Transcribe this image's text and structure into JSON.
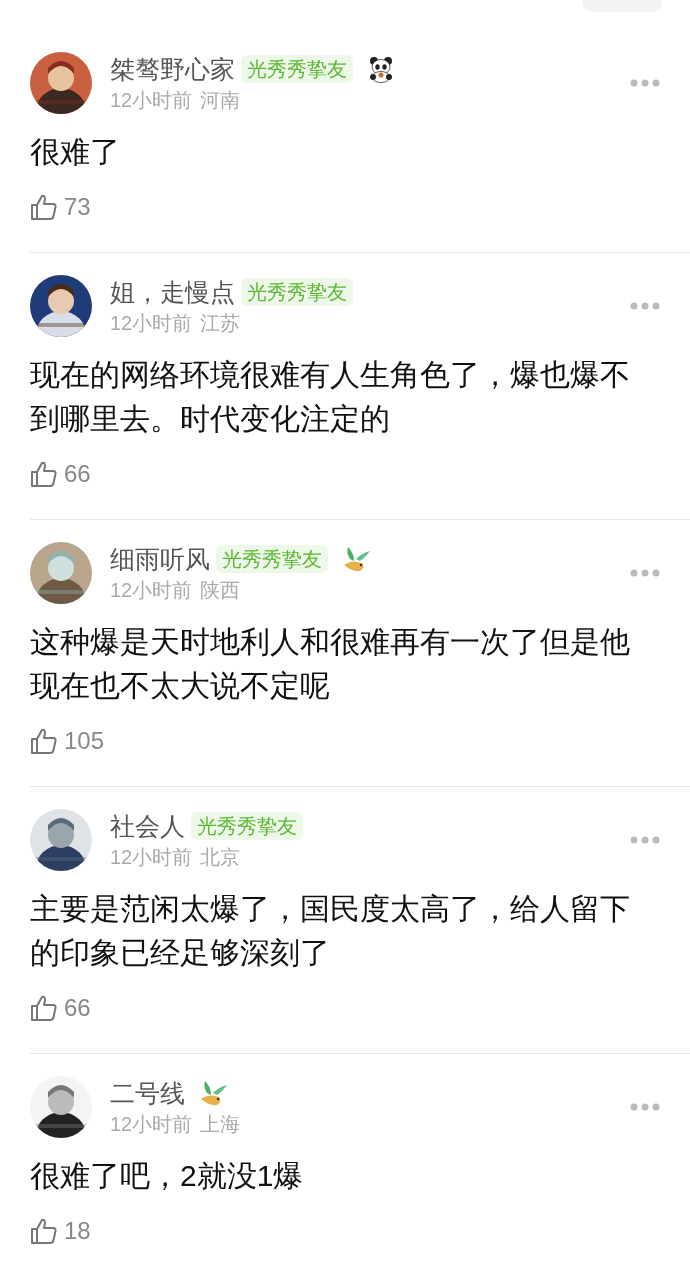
{
  "comments": [
    {
      "name": "桀骜野心家",
      "badge": "光秀秀挚友",
      "emblem": {
        "kind": "panda"
      },
      "time": "12小时前",
      "region": "河南",
      "text": "很难了",
      "likes": "73"
    },
    {
      "name": "姐，走慢点",
      "badge": "光秀秀挚友",
      "time": "12小时前",
      "region": "江苏",
      "text": "现在的网络环境很难有人生角色了，爆也爆不到哪里去。时代变化注定的",
      "likes": "66"
    },
    {
      "name": "细雨听风",
      "badge": "光秀秀挚友",
      "emblem": {
        "kind": "bird"
      },
      "time": "12小时前",
      "region": "陕西",
      "text": "这种爆是天时地利人和很难再有一次了但是他现在也不太大说不定呢",
      "likes": "105"
    },
    {
      "name": "社会人",
      "badge": "光秀秀挚友",
      "time": "12小时前",
      "region": "北京",
      "text": "主要是范闲太爆了，国民度太高了，给人留下的印象已经足够深刻了",
      "likes": "66"
    },
    {
      "name": "二号线",
      "emblem": {
        "kind": "bird"
      },
      "time": "12小时前",
      "region": "上海",
      "text": "很难了吧，2就没1爆",
      "likes": "18"
    }
  ]
}
